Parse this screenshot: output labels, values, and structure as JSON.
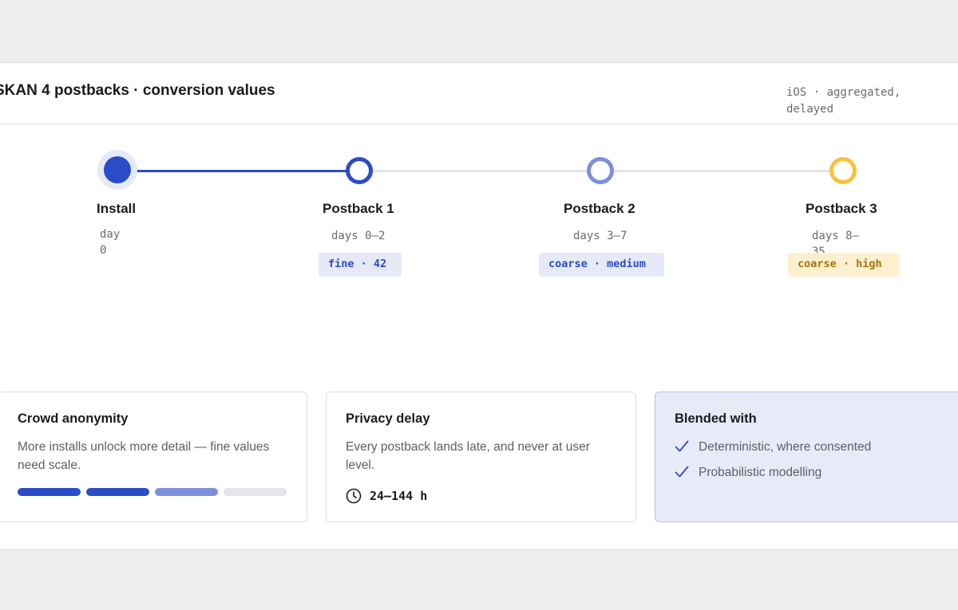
{
  "header": {
    "title": "SKAN 4 postbacks · conversion values",
    "meta": "iOS · aggregated, delayed"
  },
  "timeline": {
    "stages": [
      {
        "label": "Install",
        "window": "day 0"
      },
      {
        "label": "Postback 1",
        "window": "days 0–2",
        "badge": "fine · 42"
      },
      {
        "label": "Postback 2",
        "window": "days 3–7",
        "badge": "coarse · medium"
      },
      {
        "label": "Postback 3",
        "window": "days 8–35",
        "badge": "coarse · high"
      }
    ]
  },
  "cards": {
    "crowd": {
      "title": "Crowd anonymity",
      "body": "More installs unlock more detail — fine values need scale.",
      "levels_unlocked": 3,
      "levels_total": 4
    },
    "privacy": {
      "title": "Privacy delay",
      "body": "Every postback lands late, and never at user level.",
      "icon": "clock-icon",
      "value": "24–144 h"
    },
    "blended": {
      "title": "Blended with",
      "items": [
        "Deterministic, where consented",
        "Probabilistic modelling"
      ],
      "icon": "check-icon"
    }
  },
  "colors": {
    "primary": "#2b4cc7",
    "medium": "#7b8fdc",
    "high": "#f7c23a",
    "track": "#e4e5ea",
    "badge_fine_bg": "#e6e9f8",
    "badge_high_bg": "#fdf0cf",
    "badge_high_text": "#a8720a"
  }
}
